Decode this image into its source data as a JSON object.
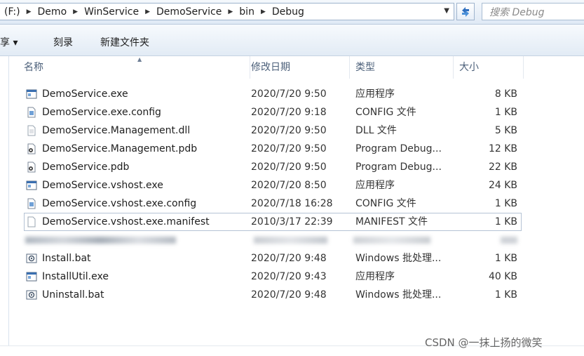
{
  "address": {
    "segments": [
      "(F:)",
      "Demo",
      "WinService",
      "DemoService",
      "bin",
      "Debug"
    ],
    "search_placeholder": "搜索 Debug"
  },
  "toolbar": {
    "share_label": "共享 ▾",
    "burn_label": "刻录",
    "new_folder_label": "新建文件夹"
  },
  "columns": {
    "name": "名称",
    "date": "修改日期",
    "type": "类型",
    "size": "大小"
  },
  "files": [
    {
      "name": "DemoService.exe",
      "date": "2020/7/20 9:50",
      "type": "应用程序",
      "size": "8 KB",
      "icon": "exe-icon"
    },
    {
      "name": "DemoService.exe.config",
      "date": "2020/7/20 9:18",
      "type": "CONFIG 文件",
      "size": "1 KB",
      "icon": "config-file-icon"
    },
    {
      "name": "DemoService.Management.dll",
      "date": "2020/7/20 9:50",
      "type": "DLL 文件",
      "size": "5 KB",
      "icon": "dll-file-icon"
    },
    {
      "name": "DemoService.Management.pdb",
      "date": "2020/7/20 9:50",
      "type": "Program Debug...",
      "size": "12 KB",
      "icon": "pdb-file-icon"
    },
    {
      "name": "DemoService.pdb",
      "date": "2020/7/20 9:50",
      "type": "Program Debug...",
      "size": "22 KB",
      "icon": "pdb-file-icon"
    },
    {
      "name": "DemoService.vshost.exe",
      "date": "2020/7/20 8:50",
      "type": "应用程序",
      "size": "24 KB",
      "icon": "exe-icon"
    },
    {
      "name": "DemoService.vshost.exe.config",
      "date": "2020/7/18 16:28",
      "type": "CONFIG 文件",
      "size": "1 KB",
      "icon": "config-file-icon"
    },
    {
      "name": "DemoService.vshost.exe.manifest",
      "date": "2010/3/17 22:39",
      "type": "MANIFEST 文件",
      "size": "1 KB",
      "icon": "blank-file-icon"
    },
    {
      "name": "",
      "date": "",
      "type": "",
      "size": "",
      "icon": "blurred-file-icon"
    },
    {
      "name": "Install.bat",
      "date": "2020/7/20 9:48",
      "type": "Windows 批处理...",
      "size": "1 KB",
      "icon": "bat-file-icon"
    },
    {
      "name": "InstallUtil.exe",
      "date": "2020/7/20 9:43",
      "type": "应用程序",
      "size": "40 KB",
      "icon": "exe-icon"
    },
    {
      "name": "Uninstall.bat",
      "date": "2020/7/20 9:48",
      "type": "Windows 批处理...",
      "size": "1 KB",
      "icon": "bat-file-icon"
    }
  ],
  "watermark": "CSDN @一抹上扬的微笑"
}
